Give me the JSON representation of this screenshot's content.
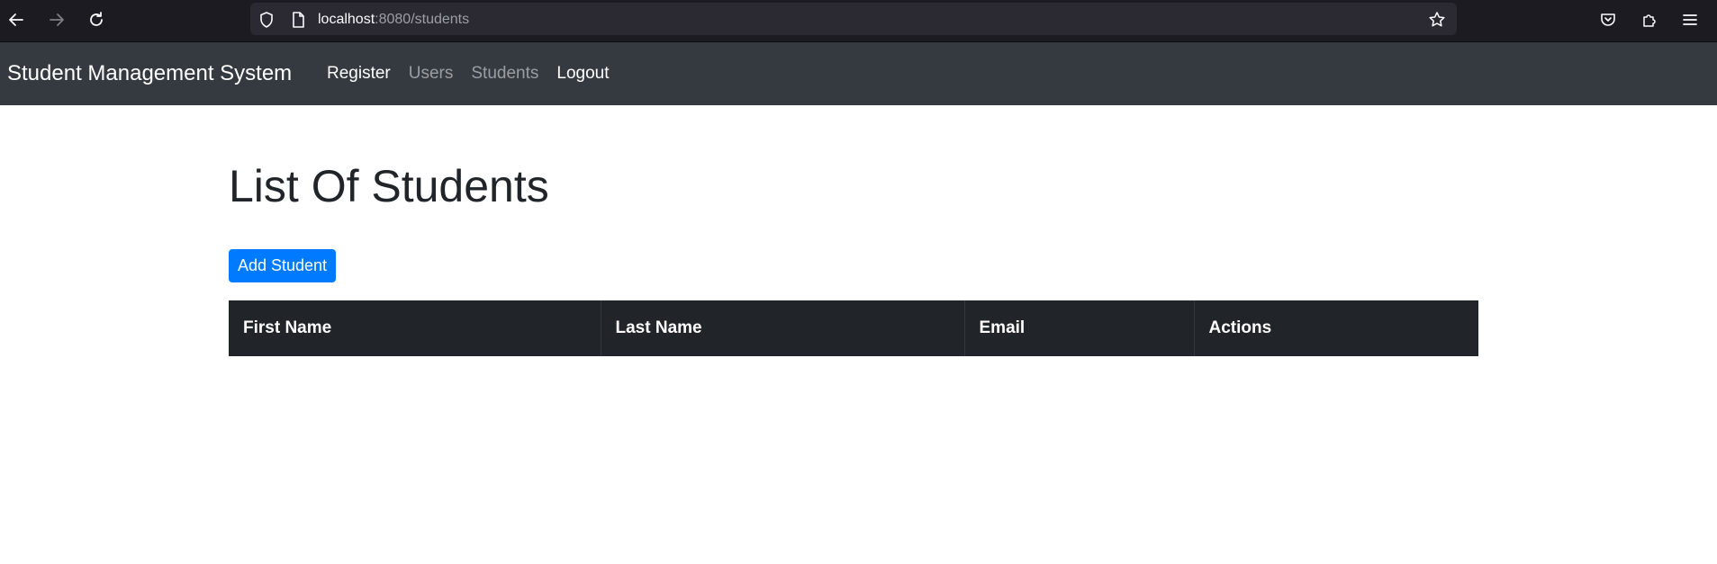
{
  "browser": {
    "url_host": "localhost",
    "url_rest": ":8080/students"
  },
  "navbar": {
    "brand": "Student Management System",
    "links": [
      "Register",
      "Users",
      "Students",
      "Logout"
    ]
  },
  "page": {
    "title": "List Of Students",
    "add_button_label": "Add Student"
  },
  "table": {
    "columns": [
      "First Name",
      "Last Name",
      "Email",
      "Actions"
    ],
    "rows": []
  },
  "colors": {
    "navbar_bg": "#343a40",
    "primary": "#007bff",
    "table_header_bg": "#212529",
    "browser_bg": "#1c1b22"
  },
  "icons": [
    "back-arrow-icon",
    "forward-arrow-icon",
    "reload-icon",
    "shield-icon",
    "page-icon",
    "bookmark-star-icon",
    "pocket-icon",
    "extensions-icon",
    "menu-icon"
  ]
}
